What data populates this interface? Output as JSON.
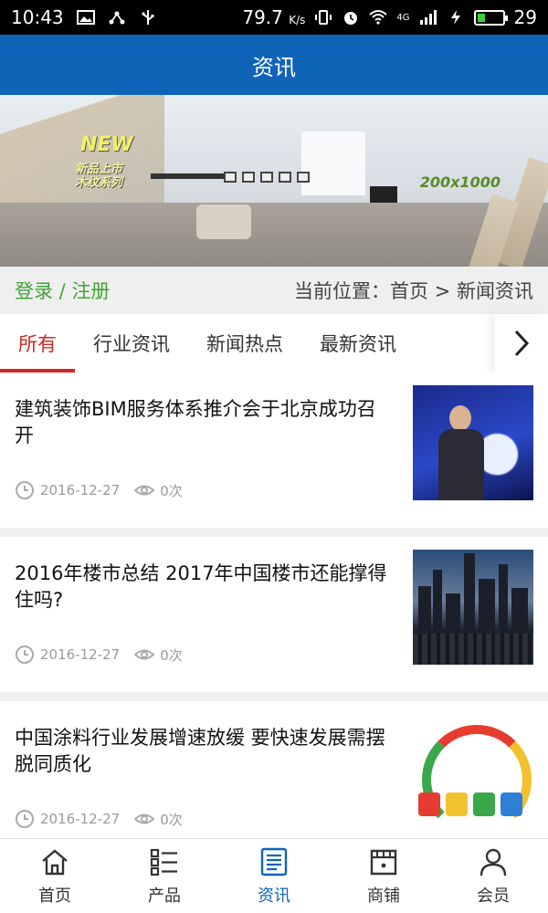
{
  "status_bar": {
    "time": "10:43",
    "speed": "79.7",
    "speed_unit": "K/s",
    "signal_label": "4G",
    "battery": "29",
    "battery_level": 0.29,
    "battery_color": "#3ed13e"
  },
  "header": {
    "title": "资讯",
    "color": "#0f64b8"
  },
  "banner": {
    "badge_new": "NEW",
    "badge_line1": "新品上市",
    "badge_line2": "木纹系列",
    "size_label": "200x1000"
  },
  "breadcrumb": {
    "login": "登录",
    "separator": " / ",
    "register": "注册",
    "location_prefix": "当前位置：",
    "home": "首页",
    "arrow": " > ",
    "current": "新闻资讯"
  },
  "tabs": [
    {
      "label": "所有",
      "active": true
    },
    {
      "label": "行业资讯",
      "active": false
    },
    {
      "label": "新闻热点",
      "active": false
    },
    {
      "label": "最新资讯",
      "active": false
    }
  ],
  "news": [
    {
      "title": "建筑装饰BIM服务体系推介会于北京成功召开",
      "date": "2016-12-27",
      "views": "0次"
    },
    {
      "title": "2016年楼市总结 2017年中国楼市还能撑得住吗?",
      "date": "2016-12-27",
      "views": "0次"
    },
    {
      "title": "中国涂料行业发展增速放缓 要快速发展需摆脱同质化",
      "date": "2016-12-27",
      "views": "0次"
    }
  ],
  "bottom_nav": [
    {
      "label": "首页",
      "icon": "home-icon",
      "active": false
    },
    {
      "label": "产品",
      "icon": "list-icon",
      "active": false
    },
    {
      "label": "资讯",
      "icon": "news-icon",
      "active": true
    },
    {
      "label": "商铺",
      "icon": "shop-icon",
      "active": false
    },
    {
      "label": "会员",
      "icon": "user-icon",
      "active": false
    }
  ],
  "colors": {
    "accent_red": "#d0261f",
    "login_green": "#3fa433"
  }
}
